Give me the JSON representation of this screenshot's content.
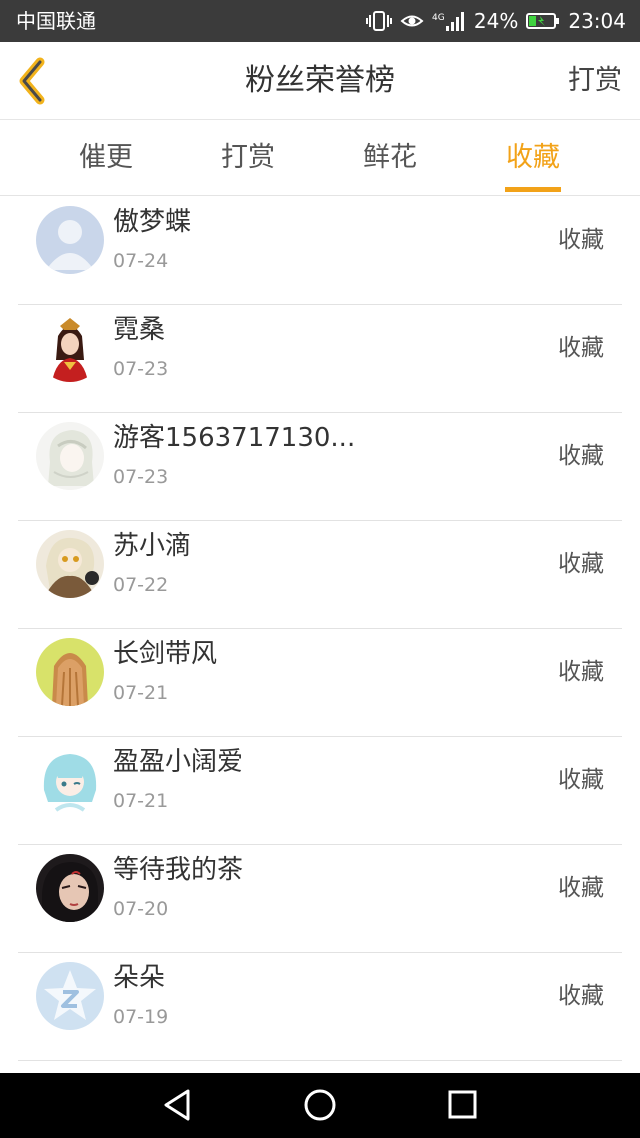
{
  "status_bar": {
    "carrier": "中国联通",
    "network": "4G",
    "battery": "24%",
    "time": "23:04"
  },
  "header": {
    "title": "粉丝荣誉榜",
    "action_label": "打赏"
  },
  "tabs": {
    "items": [
      {
        "label": "催更"
      },
      {
        "label": "打赏"
      },
      {
        "label": "鲜花"
      },
      {
        "label": "收藏"
      }
    ],
    "active": "收藏",
    "accent_color": "#f2a218"
  },
  "list": {
    "items": [
      {
        "name": "傲梦蝶",
        "date": "07-24",
        "kind": "收藏",
        "avatar": "default-person-avatar"
      },
      {
        "name": "霓桑",
        "date": "07-23",
        "kind": "收藏",
        "avatar": "ancient-queen-avatar"
      },
      {
        "name": "游客1563717130...",
        "date": "07-23",
        "kind": "收藏",
        "avatar": "white-hair-girl-avatar"
      },
      {
        "name": "苏小滴",
        "date": "07-22",
        "kind": "收藏",
        "avatar": "anime-girl-avatar"
      },
      {
        "name": "长剑带风",
        "date": "07-21",
        "kind": "收藏",
        "avatar": "long-hair-back-avatar"
      },
      {
        "name": "盈盈小阔爱",
        "date": "07-21",
        "kind": "收藏",
        "avatar": "blue-hair-chibi-avatar"
      },
      {
        "name": "等待我的茶",
        "date": "07-20",
        "kind": "收藏",
        "avatar": "dark-hair-man-avatar"
      },
      {
        "name": "朵朵",
        "date": "07-19",
        "kind": "收藏",
        "avatar": "qzone-star-avatar"
      }
    ]
  },
  "nav_bar": {
    "buttons": [
      "back-triangle-icon",
      "home-circle-icon",
      "recents-square-icon"
    ]
  }
}
